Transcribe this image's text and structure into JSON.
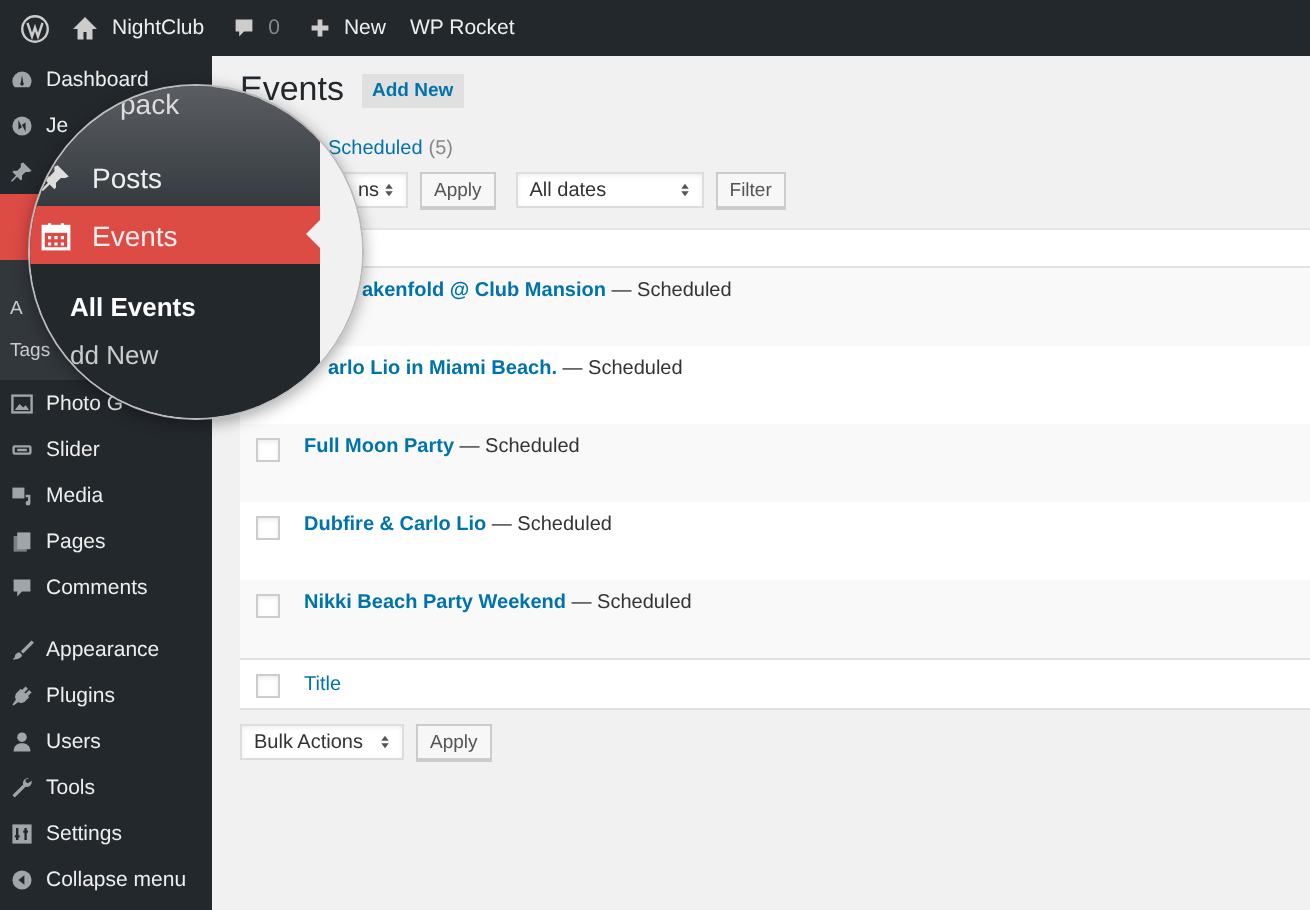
{
  "admin_bar": {
    "site_name": "NightClub",
    "comments_count": "0",
    "new_label": "New",
    "plugin_link": "WP Rocket"
  },
  "sidebar": {
    "groups": [
      {
        "items": [
          {
            "label": "Dashboard",
            "selected": false
          },
          {
            "label": "Je",
            "selected": false
          },
          {
            "selected": false
          },
          {
            "selected": true,
            "children": [
              {
                "label": "A"
              },
              {
                "label": "Tags"
              }
            ]
          },
          {
            "label": "Photo G",
            "selected": false
          },
          {
            "label": "Slider",
            "selected": false
          },
          {
            "label": "Media",
            "selected": false
          },
          {
            "label": "Pages",
            "selected": false
          },
          {
            "label": "Comments",
            "selected": false
          }
        ]
      },
      {
        "items": [
          {
            "label": "Appearance",
            "selected": false
          },
          {
            "label": "Plugins",
            "selected": false
          },
          {
            "label": "Users",
            "selected": false
          },
          {
            "label": "Tools",
            "selected": false
          },
          {
            "label": "Settings",
            "selected": false
          }
        ]
      }
    ],
    "collapse_label": "Collapse menu"
  },
  "magnifier": {
    "items": [
      {
        "label": "pack",
        "selected": false
      },
      {
        "label": "Posts",
        "selected": false
      },
      {
        "label": "Events",
        "selected": true,
        "children": [
          {
            "label": "All Events",
            "selected": true
          },
          {
            "label": "dd New",
            "selected": false
          }
        ]
      }
    ]
  },
  "page": {
    "title": "Events",
    "add_new": "Add New",
    "views": [
      {
        "label": "Scheduled",
        "count": "(5)"
      }
    ],
    "bulk_actions": "ns",
    "apply": "Apply",
    "date_filter": "All dates",
    "filter": "Filter",
    "rows": [
      {
        "title": "akenfold @ Club Mansion",
        "status": "— Scheduled"
      },
      {
        "title": "arlo Lio in Miami Beach.",
        "status": "— Scheduled"
      },
      {
        "title": "Full Moon Party",
        "status": "— Scheduled",
        "checked": false
      },
      {
        "title": "Dubfire & Carlo Lio",
        "status": "— Scheduled",
        "checked": false
      },
      {
        "title": "Nikki Beach Party Weekend",
        "status": "— Scheduled",
        "checked": false
      }
    ],
    "footer_column": "Title",
    "footer_checked": false,
    "bulk_actions_bottom": "Bulk Actions",
    "apply_bottom": "Apply"
  }
}
